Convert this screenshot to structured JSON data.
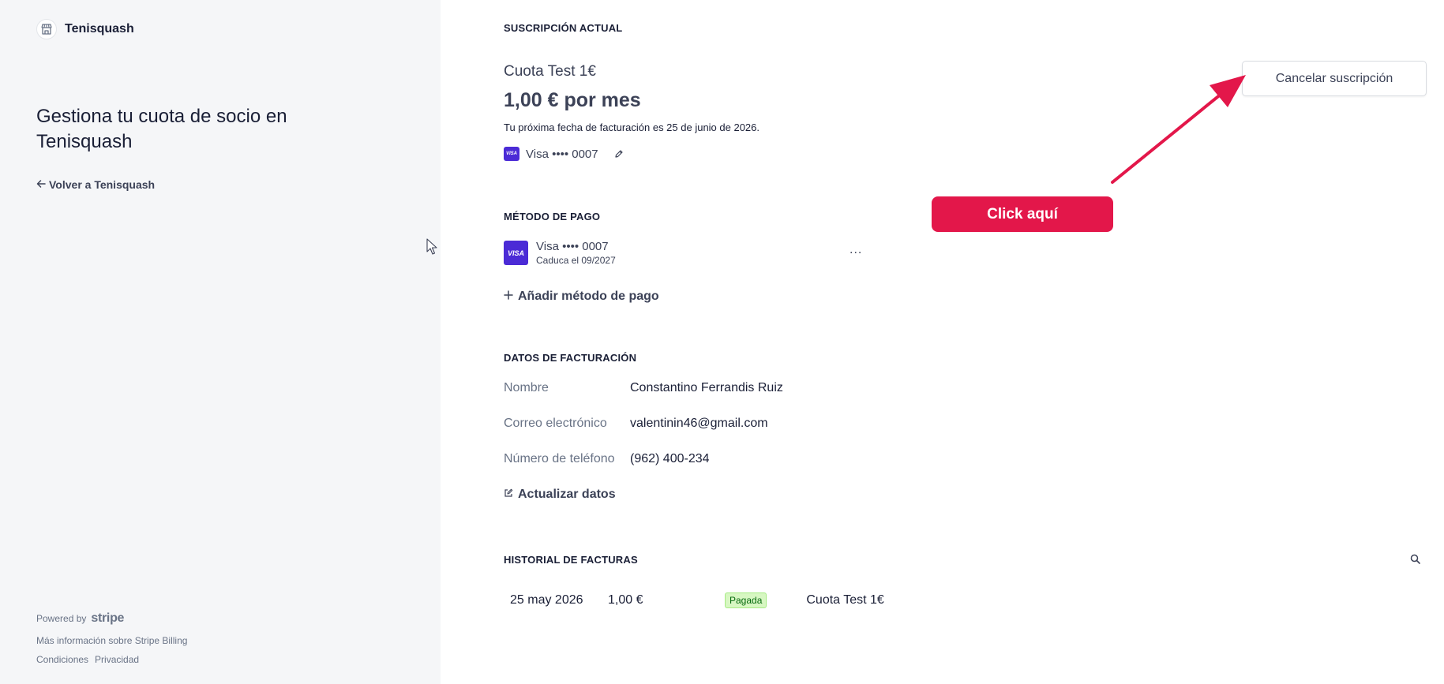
{
  "brand": {
    "name": "Tenisquash",
    "icon": "store-icon"
  },
  "hero": {
    "title": "Gestiona tu cuota de socio en Tenisquash"
  },
  "back_link": {
    "label": "Volver a Tenisquash",
    "icon": "arrow-left-icon"
  },
  "footer": {
    "powered_by": "Powered by",
    "stripe": "stripe",
    "more_info": "Más información sobre Stripe Billing",
    "terms": "Condiciones",
    "privacy": "Privacidad"
  },
  "subscription": {
    "section_title": "SUSCRIPCIÓN ACTUAL",
    "plan_name": "Cuota Test 1€",
    "price": "1,00 € por mes",
    "next_billing": "Tu próxima fecha de facturación es 25 de junio de 2026.",
    "card": "Visa •••• 0007",
    "cancel_label": "Cancelar suscripción"
  },
  "callout": {
    "label": "Click aquí",
    "color": "#e3174a"
  },
  "payment_method": {
    "section_title": "MÉTODO DE PAGO",
    "brand_mark": "VISA",
    "card": "Visa •••• 0007",
    "expiry": "Caduca el 09/2027",
    "more": "...",
    "add_label": "Añadir método de pago"
  },
  "billing": {
    "section_title": "DATOS DE FACTURACIÓN",
    "rows": [
      {
        "label": "Nombre",
        "value": "Constantino Ferrandis Ruiz"
      },
      {
        "label": "Correo electrónico",
        "value": "valentinin46@gmail.com"
      },
      {
        "label": "Número de teléfono",
        "value": "(962) 400-234"
      }
    ],
    "update_label": "Actualizar datos"
  },
  "invoices": {
    "section_title": "HISTORIAL DE FACTURAS",
    "rows": [
      {
        "date": "25 may 2026",
        "amount": "1,00 €",
        "status": "Pagada",
        "description": "Cuota Test 1€"
      }
    ]
  },
  "colors": {
    "visa": "#4b2bd6",
    "accent": "#e3174a",
    "paid_bg": "#d7f7c2",
    "paid_text": "#05690d"
  }
}
